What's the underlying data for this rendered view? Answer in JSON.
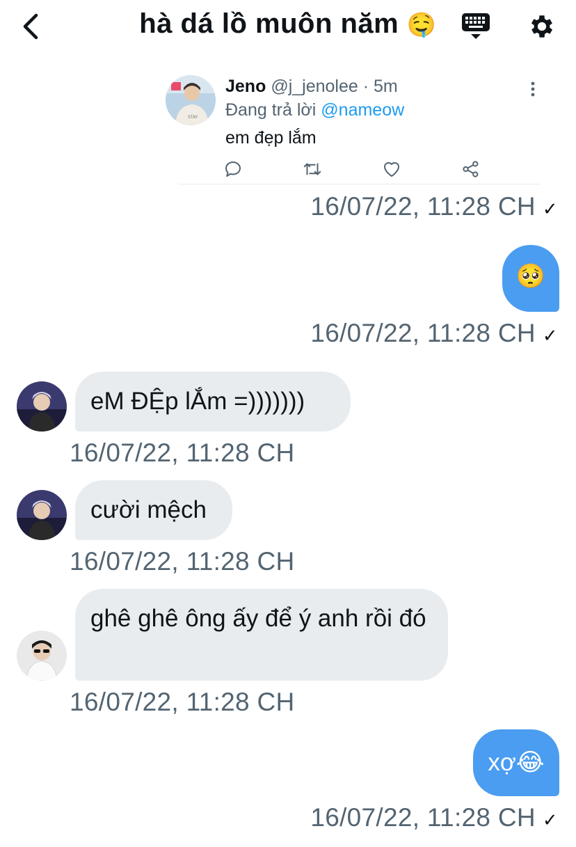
{
  "header": {
    "title": "hà dá lồ muôn năm",
    "title_emoji": "🤤"
  },
  "shared_tweet": {
    "name": "Jeno",
    "handle": "@j_jenolee",
    "separator": "·",
    "time": "5m",
    "reply_prefix": "Đang trả lời",
    "reply_to": "@nameow",
    "text": "em đẹp lắm"
  },
  "messages": [
    {
      "side": "out",
      "kind": "tweet-share",
      "timestamp": "16/07/22, 11:28 CH",
      "check": "✓"
    },
    {
      "side": "out",
      "text": "🥺",
      "timestamp": "16/07/22, 11:28 CH",
      "check": "✓"
    },
    {
      "side": "in",
      "text": "eM ĐỆp lẮm =)))))))",
      "timestamp": "16/07/22, 11:28 CH"
    },
    {
      "side": "in",
      "text": "cười mệch",
      "timestamp": "16/07/22, 11:28 CH"
    },
    {
      "side": "in",
      "text": "ghê ghê ông ấy để ý anh rồi đó",
      "timestamp": "16/07/22, 11:28 CH"
    },
    {
      "side": "out",
      "text": "xợ😂",
      "timestamp": "16/07/22, 11:28 CH",
      "check": "✓"
    }
  ],
  "colors": {
    "outgoing_bubble": "#4a9df0",
    "incoming_bubble": "#e8ecef",
    "mention": "#1d9bf0",
    "secondary_text": "#536471"
  },
  "icons": [
    "back-arrow-icon",
    "keyboard-icon",
    "gear-icon",
    "more-vertical-icon",
    "reply-icon",
    "retweet-icon",
    "like-icon",
    "share-icon"
  ]
}
